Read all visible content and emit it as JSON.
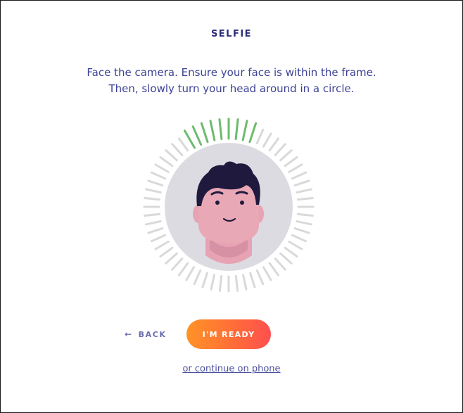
{
  "header": {
    "title": "SELFIE"
  },
  "instructions": {
    "line1": "Face the camera. Ensure your face is within the frame.",
    "line2": "Then, slowly turn your head around in a circle."
  },
  "progress_ring": {
    "ticks_total": 60,
    "ticks_complete": 9,
    "complete_color": "#6dbb6d",
    "incomplete_color": "#d9d9d9"
  },
  "avatar": {
    "icon": "selfie-face-illustration",
    "background": "#dcdbe1"
  },
  "actions": {
    "back_label": "BACK",
    "back_icon": "arrow-left-icon",
    "ready_label": "I'M READY",
    "phone_link_label": "or continue on phone"
  },
  "colors": {
    "title": "#2b2f7a",
    "text": "#3d4396",
    "accent_start": "#ff9326",
    "accent_end": "#ff4f4f"
  }
}
